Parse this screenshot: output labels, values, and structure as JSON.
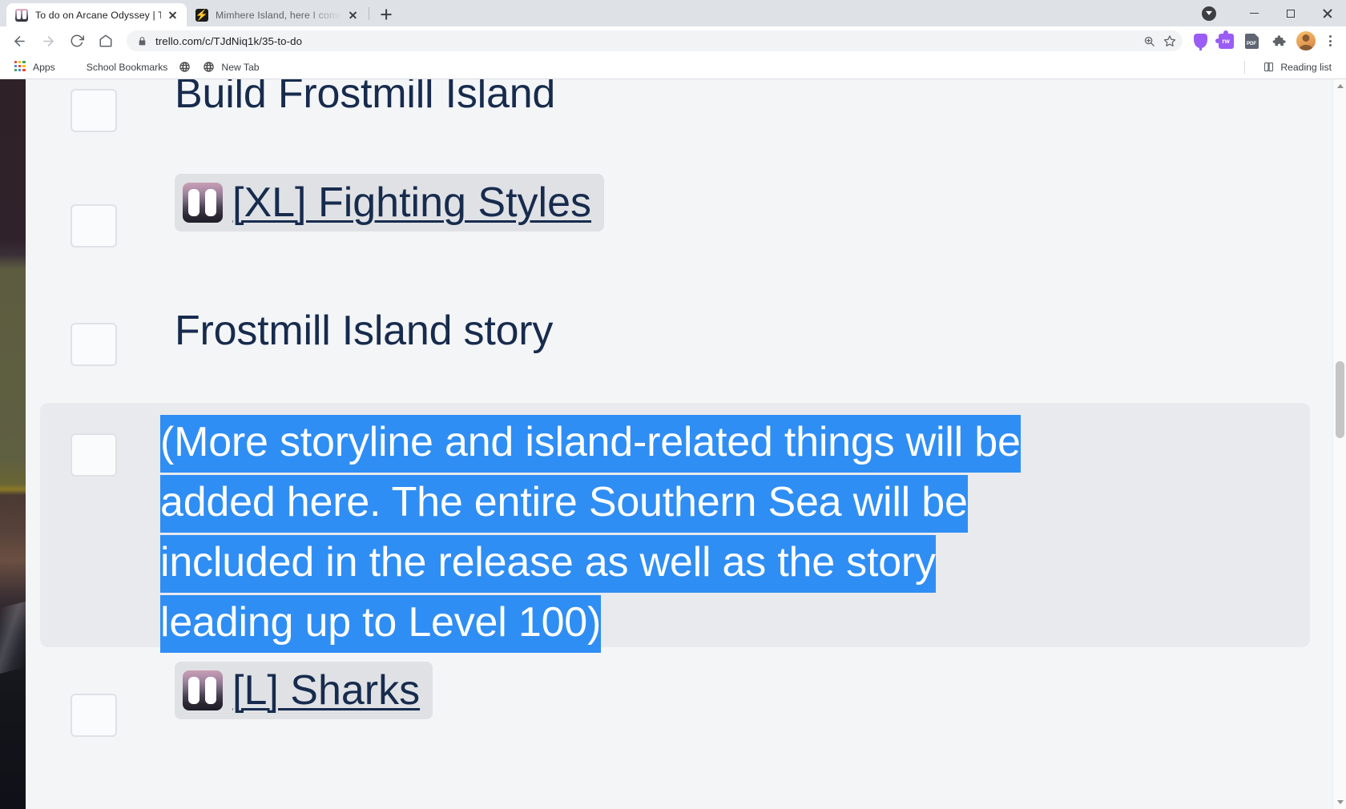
{
  "browser": {
    "tabs": [
      {
        "title": "To do on Arcane Odyssey | Trello",
        "favicon": "trello-favicon",
        "active": true
      },
      {
        "title": "Mimhere Island, here I come - Ga",
        "favicon": "game-favicon",
        "active": false
      }
    ],
    "new_tab_label": "+",
    "window_controls": {
      "download_indicator": "download-chevron-icon",
      "minimize": "minimize-icon",
      "maximize": "maximize-icon",
      "close": "close-icon"
    },
    "toolbar": {
      "back": "back-arrow-icon",
      "forward": "forward-arrow-icon",
      "reload": "reload-icon",
      "home": "home-icon",
      "security": "lock-icon",
      "url": "trello.com/c/TJdNiq1k/35-to-do",
      "zoom": "zoom-magnifier-icon",
      "bookmark": "star-icon",
      "extensions": [
        {
          "name": "purple-tulip-extension-icon",
          "label": ""
        },
        {
          "name": "puzzle-extension-icon",
          "label": "rw"
        },
        {
          "name": "pdf-extension-icon",
          "label": "PDF"
        }
      ],
      "extension_menu": "puzzle-piece-icon",
      "profile": "profile-avatar",
      "menu": "three-dot-menu-icon"
    },
    "bookmarks": [
      {
        "label": "Apps",
        "icon": "apps-grid-icon"
      },
      {
        "label": "School Bookmarks",
        "icon": "folder-icon"
      },
      {
        "label": "",
        "icon": "globe-icon"
      },
      {
        "label": "New Tab",
        "icon": "globe-icon"
      }
    ],
    "reading_list": {
      "label": "Reading list",
      "icon": "reading-list-icon"
    }
  },
  "page": {
    "checklist": [
      {
        "id": "build-frostmill-island",
        "type": "text",
        "text": "Build Frostmill Island",
        "checked": false
      },
      {
        "id": "xl-fighting-styles",
        "type": "card-link",
        "text": "[XL] Fighting Styles",
        "card_icon": "trello-card-thumbnail",
        "checked": false
      },
      {
        "id": "frostmill-island-story",
        "type": "text",
        "text": "Frostmill Island story",
        "checked": false
      },
      {
        "id": "more-storyline-note",
        "type": "paragraph",
        "text": "(More storyline and island-related things will be added here. The entire Southern Sea will be included in the release as well as the story leading up to Level 100)",
        "selected": true,
        "checked": false,
        "hovered": true
      },
      {
        "id": "l-sharks",
        "type": "card-link",
        "text": "[L] Sharks",
        "card_icon": "trello-card-thumbnail",
        "checked": false
      }
    ]
  },
  "colors": {
    "selection_blue": "#2f8ef4",
    "text_navy": "#172b4d",
    "page_bg": "#f4f5f7",
    "hover_row": "#e9eaee",
    "card_chip": "#dfe1e5",
    "checkbox_border": "#dfe1e6"
  }
}
